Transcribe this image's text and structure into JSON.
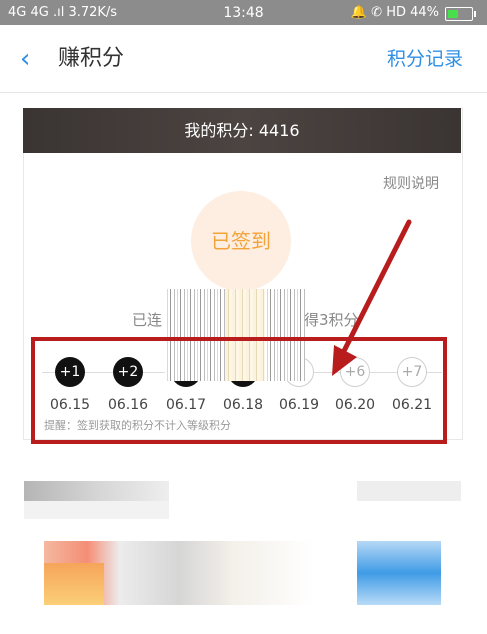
{
  "status_bar": {
    "left": "4G 4G .ıl 3.72K/s",
    "time": "13:48",
    "right": "🔔 ✆ HD 44%",
    "battery_level": 0.44
  },
  "header": {
    "back_glyph": "‹",
    "title": "赚积分",
    "record_link": "积分记录"
  },
  "card": {
    "points_label": "我的积分: 4416",
    "rules_link": "规则说明",
    "checked_label": "已签到",
    "streak_left": "已连",
    "streak_right": "得3积分",
    "note": "提醒：签到获取的积分不计入等级积分",
    "days": [
      {
        "bonus": "+1",
        "date": "06.15",
        "done": true
      },
      {
        "bonus": "+2",
        "date": "06.16",
        "done": true
      },
      {
        "bonus": "",
        "date": "06.17",
        "done": true
      },
      {
        "bonus": "",
        "date": "06.18",
        "done": true
      },
      {
        "bonus": "5",
        "date": "06.19",
        "done": false
      },
      {
        "bonus": "+6",
        "date": "06.20",
        "done": false
      },
      {
        "bonus": "+7",
        "date": "06.21",
        "done": false
      }
    ]
  },
  "colors": {
    "accent": "#2f8fe5",
    "highlight": "#b81c1c",
    "checked": "#f2a43a"
  }
}
